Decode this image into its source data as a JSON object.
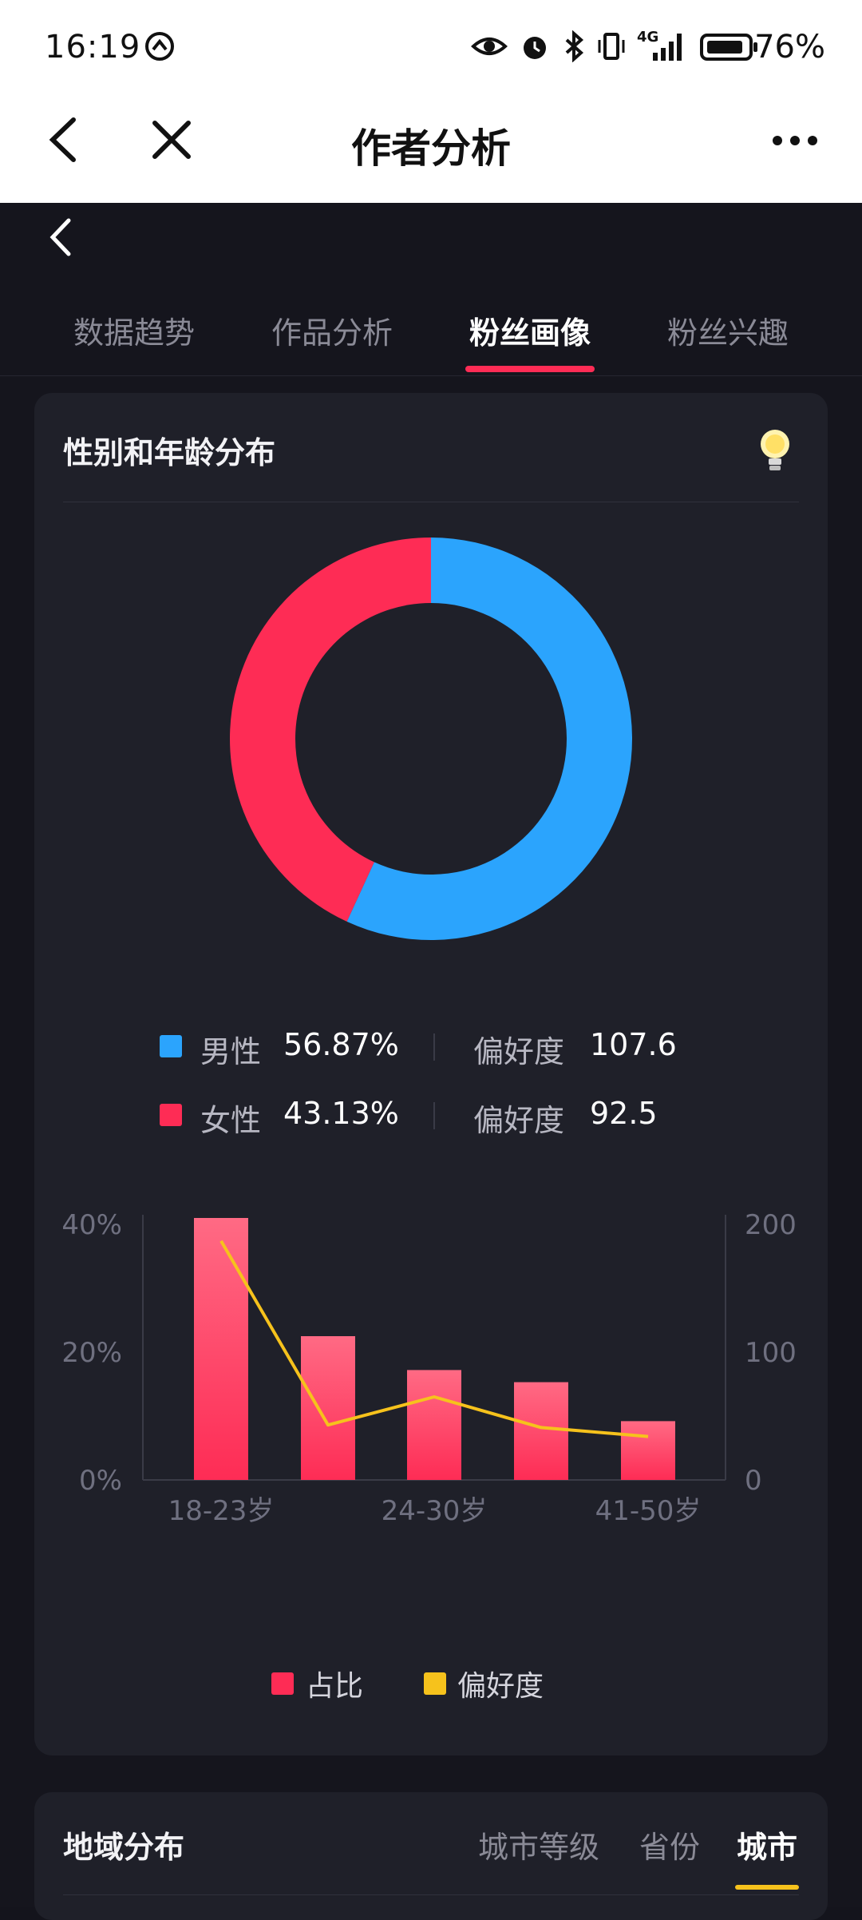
{
  "status": {
    "time": "16:19",
    "battery": "76%",
    "network": "4G"
  },
  "header": {
    "title": "作者分析"
  },
  "tabs": [
    {
      "label": "数据趋势",
      "active": false
    },
    {
      "label": "作品分析",
      "active": false
    },
    {
      "label": "粉丝画像",
      "active": true
    },
    {
      "label": "粉丝兴趣",
      "active": false
    }
  ],
  "gender_card": {
    "title": "性别和年龄分布",
    "legend": [
      {
        "label": "男性",
        "value": "56.87%",
        "pref_label": "偏好度",
        "pref_value": "107.6",
        "color": "#2ba4fd"
      },
      {
        "label": "女性",
        "value": "43.13%",
        "pref_label": "偏好度",
        "pref_value": "92.5",
        "color": "#fe2c55"
      }
    ],
    "bottom_legend": [
      {
        "label": "占比",
        "color": "#fe2c55"
      },
      {
        "label": "偏好度",
        "color": "#f6c21c"
      }
    ]
  },
  "region_card": {
    "title": "地域分布",
    "tabs": [
      {
        "label": "城市等级",
        "active": false
      },
      {
        "label": "省份",
        "active": false
      },
      {
        "label": "城市",
        "active": true
      }
    ]
  },
  "chart_data": [
    {
      "type": "pie",
      "donut": true,
      "labels": [
        "男性",
        "女性"
      ],
      "values": [
        56.87,
        43.13
      ],
      "colors": [
        "#2ba4fd",
        "#fe2c55"
      ]
    },
    {
      "type": "bar",
      "categories": [
        "18-23岁",
        "",
        "24-30岁",
        "",
        "41-50岁"
      ],
      "series": [
        {
          "name": "占比",
          "axis": "left",
          "values": [
            41,
            22.5,
            17.2,
            15.3,
            9.2
          ],
          "color": "#fe2c55"
        },
        {
          "name": "偏好度",
          "type": "line",
          "axis": "right",
          "values": [
            187,
            43,
            65,
            41,
            34
          ],
          "color": "#f6c21c"
        }
      ],
      "y_left": {
        "ticks": [
          "0%",
          "20%",
          "40%"
        ],
        "range": [
          0,
          40
        ]
      },
      "y_right": {
        "ticks": [
          "0",
          "100",
          "200"
        ],
        "range": [
          0,
          200
        ]
      },
      "grid": false
    }
  ]
}
